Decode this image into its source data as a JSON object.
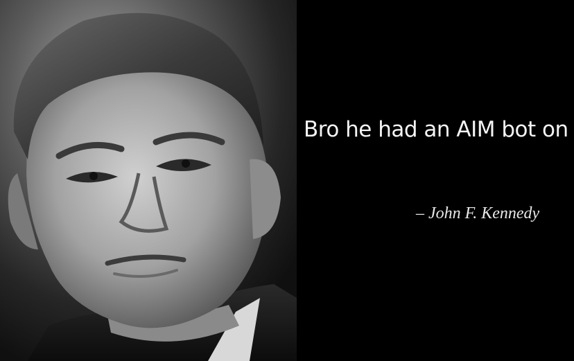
{
  "quote": {
    "text": "Bro he had an AIM bot on",
    "attribution": "– John F. Kennedy"
  },
  "colors": {
    "background": "#000000",
    "quote_text": "#f4f4f4",
    "attribution_text": "#e8e8e8"
  }
}
